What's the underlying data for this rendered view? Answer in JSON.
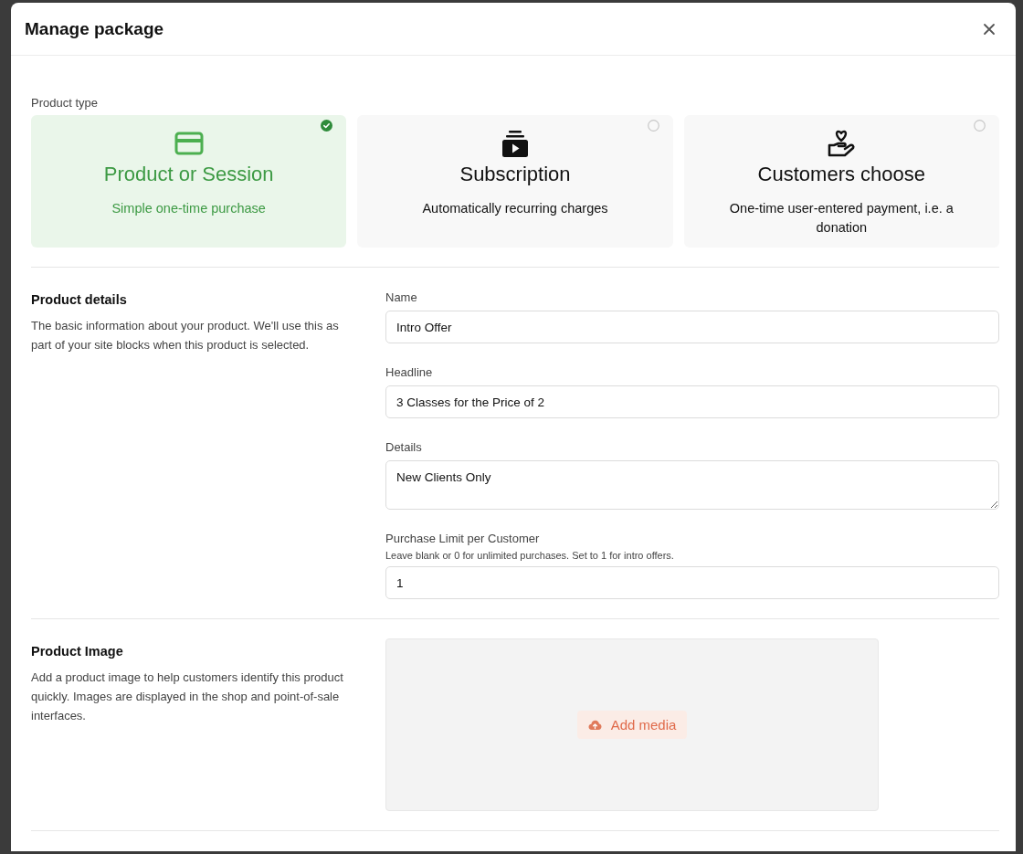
{
  "dialog": {
    "title": "Manage package"
  },
  "product_type": {
    "label": "Product type",
    "options": [
      {
        "title": "Product or Session",
        "description": "Simple one-time purchase",
        "selected": true
      },
      {
        "title": "Subscription",
        "description": "Automatically recurring charges",
        "selected": false
      },
      {
        "title": "Customers choose",
        "description": "One-time user-entered payment, i.e. a donation",
        "selected": false
      }
    ]
  },
  "sections": [
    {
      "kind": "fields",
      "title": "Product details",
      "description": "The basic information about your product. We'll use this as part of your site blocks when this product is selected.",
      "fields": [
        {
          "kind": "input",
          "label": "Name",
          "value": "Intro Offer"
        },
        {
          "kind": "input",
          "label": "Headline",
          "value": "3 Classes for the Price of 2"
        },
        {
          "kind": "textarea",
          "label": "Details",
          "value": "New Clients Only"
        },
        {
          "kind": "input",
          "label": "Purchase Limit per Customer",
          "hint": "Leave blank or 0 for unlimited purchases. Set to 1 for intro offers.",
          "value": "1"
        }
      ]
    },
    {
      "kind": "media",
      "title": "Product Image",
      "description": "Add a product image to help customers identify this product quickly. Images are displayed in the shop and point-of-sale interfaces.",
      "button": "Add media"
    }
  ]
}
